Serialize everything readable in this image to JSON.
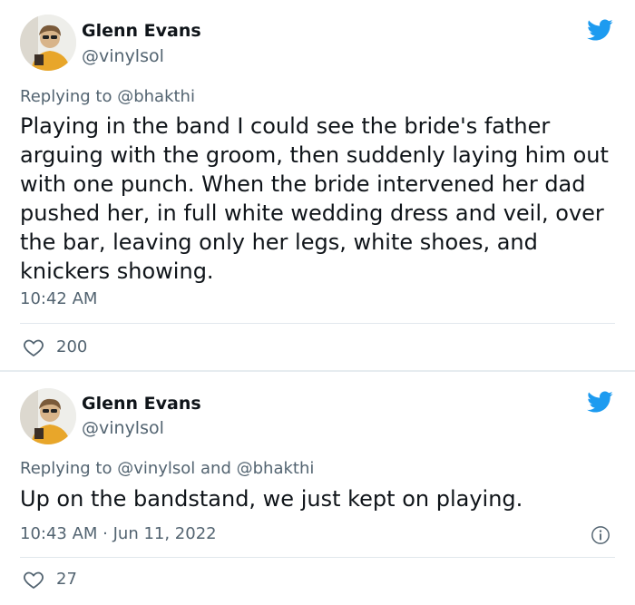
{
  "tweets": [
    {
      "author_name": "Glenn Evans",
      "author_handle": "@vinylsol",
      "reply_prefix": "Replying to ",
      "reply_mentions": "@bhakthi",
      "text": "Playing in the band I could see the bride's father arguing with the groom, then suddenly laying him out with one punch. When the bride intervened her dad pushed her, in full white wedding dress and veil, over the bar, leaving only her legs, white shoes, and knickers showing.",
      "timestamp": "10:42 AM",
      "like_count": "200",
      "icons": {
        "brand": "twitter-bird-icon",
        "like": "heart-icon"
      }
    },
    {
      "author_name": "Glenn Evans",
      "author_handle": "@vinylsol",
      "reply_prefix": "Replying to ",
      "reply_mentions": "@vinylsol and @bhakthi",
      "text": "Up on the bandstand, we just kept on playing.",
      "timestamp": "10:43 AM · Jun 11, 2022",
      "like_count": "27",
      "icons": {
        "brand": "twitter-bird-icon",
        "like": "heart-icon",
        "info": "info-icon"
      }
    }
  ],
  "colors": {
    "brand_blue": "#1d9bf0",
    "text_primary": "#0f1419",
    "text_secondary": "#536471",
    "divider": "#e1e8ed"
  }
}
